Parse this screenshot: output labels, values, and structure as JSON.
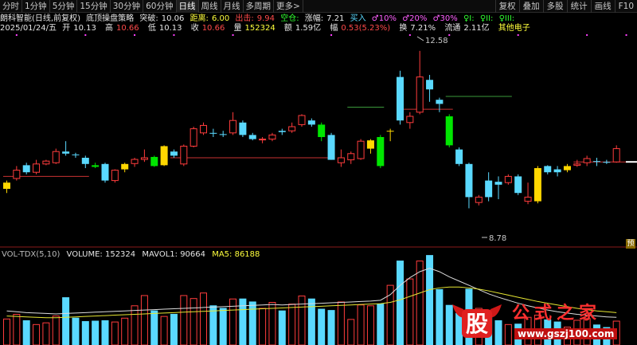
{
  "toolbar": {
    "periods": [
      "分时",
      "1分钟",
      "5分钟",
      "15分钟",
      "30分钟",
      "60分钟",
      "日线",
      "周线",
      "月线",
      "多周期",
      "更多>"
    ],
    "active_period": "日线",
    "right_tools": [
      "复权",
      "叠加",
      "多股",
      "统计",
      "画线",
      "F10"
    ]
  },
  "header": {
    "stock_name": "朗科智能(日线,前复权)",
    "strategy": "底顶操盘策略",
    "break_label": "突破:",
    "break_value": "10.06",
    "distance_label": "距离:",
    "distance_value": "6.00",
    "exit_label": "出击:",
    "exit_value": "9.94",
    "empty_label": "空仓:",
    "rise_label": "涨幅:",
    "rise_value": "7.21",
    "buy_signal": "买入",
    "male_signal_1": "♂10%",
    "male_signal_2": "♂20%",
    "male_signal_3": "♂30%",
    "female_signal_1": "♀I:",
    "female_signal_2": "♀II:",
    "female_signal_3": "♀III:"
  },
  "quote": {
    "date": "2025/01/24/五",
    "open_label": "开",
    "open": "10.13",
    "high_label": "高",
    "high": "10.66",
    "low_label": "低",
    "low": "10.13",
    "close_label": "收",
    "close": "10.66",
    "volume_label": "量",
    "volume": "152324",
    "amount_label": "额",
    "amount": "1.59亿",
    "amp_label": "幅",
    "amp": "0.53(5.23%)",
    "turnover_label": "换",
    "turnover": "7.21%",
    "float_label": "流通",
    "float": "2.11亿",
    "sector": "其他电子"
  },
  "annotations": {
    "high_marker": "12.58",
    "low_marker": "8.78"
  },
  "indicator": {
    "name": "VOL-TDX(5,10)",
    "volume": "VOLUME: 152324",
    "mavol1": "MAVOL1: 90664",
    "ma5": "MA5: 86188"
  },
  "scroll_badge": "预",
  "watermark": {
    "logo_char": "股",
    "title": "公式之家",
    "url": "www.gszj100.com"
  },
  "colors": {
    "up": "#ff3c3c",
    "down": "#5ad9ff",
    "yellow": "#ffd700",
    "green": "#00e600",
    "support": "#c83232",
    "resist": "#3a9a3a",
    "ma_white": "#dcdcdc",
    "ma_yellow": "#e6e632"
  },
  "chart_data": {
    "type": "candlestick",
    "price_ylim": [
      8.0,
      13.0
    ],
    "volume_ylim": [
      0,
      200000
    ],
    "candles": [
      {
        "o": 9.25,
        "c": 9.4,
        "h": 9.45,
        "l": 9.15,
        "st": "yellow"
      },
      {
        "o": 9.5,
        "c": 9.7,
        "h": 9.8,
        "l": 9.45,
        "st": "up"
      },
      {
        "o": 9.82,
        "c": 9.65,
        "h": 9.88,
        "l": 9.6,
        "st": "down"
      },
      {
        "o": 9.65,
        "c": 9.85,
        "h": 9.95,
        "l": 9.6,
        "st": "up"
      },
      {
        "o": 9.85,
        "c": 9.92,
        "h": 9.95,
        "l": 9.82,
        "st": "up"
      },
      {
        "o": 9.88,
        "c": 10.15,
        "h": 10.22,
        "l": 9.85,
        "st": "up"
      },
      {
        "o": 10.15,
        "c": 10.1,
        "h": 10.4,
        "l": 10.05,
        "st": "down"
      },
      {
        "o": 10.08,
        "c": 10.08,
        "h": 10.12,
        "l": 10.0,
        "st": "down"
      },
      {
        "o": 10.0,
        "c": 9.85,
        "h": 10.05,
        "l": 9.75,
        "st": "down"
      },
      {
        "o": 9.78,
        "c": 9.82,
        "h": 9.88,
        "l": 9.75,
        "st": "green"
      },
      {
        "o": 9.85,
        "c": 9.45,
        "h": 9.88,
        "l": 9.4,
        "st": "down"
      },
      {
        "o": 9.45,
        "c": 9.7,
        "h": 9.72,
        "l": 9.4,
        "st": "up"
      },
      {
        "o": 9.72,
        "c": 9.85,
        "h": 9.88,
        "l": 9.65,
        "st": "yellow"
      },
      {
        "o": 9.86,
        "c": 9.96,
        "h": 10.0,
        "l": 9.78,
        "st": "up"
      },
      {
        "o": 9.96,
        "c": 10.0,
        "h": 10.2,
        "l": 9.9,
        "st": "up"
      },
      {
        "o": 9.8,
        "c": 10.02,
        "h": 10.05,
        "l": 9.78,
        "st": "green"
      },
      {
        "o": 9.82,
        "c": 10.28,
        "h": 10.3,
        "l": 9.8,
        "st": "yellow"
      },
      {
        "o": 10.15,
        "c": 10.05,
        "h": 10.2,
        "l": 10.0,
        "st": "down"
      },
      {
        "o": 9.85,
        "c": 10.28,
        "h": 10.32,
        "l": 9.8,
        "st": "up"
      },
      {
        "o": 10.28,
        "c": 10.7,
        "h": 10.75,
        "l": 10.25,
        "st": "up"
      },
      {
        "o": 10.6,
        "c": 10.78,
        "h": 10.85,
        "l": 10.55,
        "st": "up"
      },
      {
        "o": 10.6,
        "c": 10.58,
        "h": 10.7,
        "l": 10.5,
        "st": "down"
      },
      {
        "o": 10.55,
        "c": 10.57,
        "h": 10.65,
        "l": 10.5,
        "st": "down"
      },
      {
        "o": 10.6,
        "c": 10.9,
        "h": 11.1,
        "l": 10.55,
        "st": "up"
      },
      {
        "o": 10.85,
        "c": 10.55,
        "h": 10.9,
        "l": 10.5,
        "st": "down"
      },
      {
        "o": 10.55,
        "c": 10.45,
        "h": 10.6,
        "l": 10.42,
        "st": "down"
      },
      {
        "o": 10.45,
        "c": 10.45,
        "h": 10.5,
        "l": 10.35,
        "st": "up"
      },
      {
        "o": 10.45,
        "c": 10.55,
        "h": 10.6,
        "l": 10.4,
        "st": "up"
      },
      {
        "o": 10.62,
        "c": 10.65,
        "h": 10.7,
        "l": 10.55,
        "st": "down"
      },
      {
        "o": 10.65,
        "c": 10.75,
        "h": 10.85,
        "l": 10.6,
        "st": "up"
      },
      {
        "o": 10.8,
        "c": 11.02,
        "h": 11.05,
        "l": 10.75,
        "st": "up"
      },
      {
        "o": 10.9,
        "c": 10.8,
        "h": 10.95,
        "l": 10.75,
        "st": "down"
      },
      {
        "o": 10.8,
        "c": 10.5,
        "h": 10.85,
        "l": 10.4,
        "st": "green"
      },
      {
        "o": 10.55,
        "c": 9.95,
        "h": 10.6,
        "l": 9.95,
        "st": "down"
      },
      {
        "o": 10.0,
        "c": 9.88,
        "h": 10.2,
        "l": 9.78,
        "st": "up"
      },
      {
        "o": 9.95,
        "c": 10.1,
        "h": 10.15,
        "l": 9.85,
        "st": "up"
      },
      {
        "o": 9.98,
        "c": 10.4,
        "h": 10.45,
        "l": 9.95,
        "st": "up"
      },
      {
        "o": 10.42,
        "c": 10.22,
        "h": 10.45,
        "l": 10.1,
        "st": "yellow"
      },
      {
        "o": 10.5,
        "c": 9.8,
        "h": 10.55,
        "l": 9.75,
        "st": "green"
      },
      {
        "o": 10.65,
        "c": 10.65,
        "h": 10.7,
        "l": 10.4,
        "st": "yellow"
      },
      {
        "o": 10.9,
        "c": 11.95,
        "h": 12.1,
        "l": 10.8,
        "st": "down"
      },
      {
        "o": 10.85,
        "c": 11.0,
        "h": 11.1,
        "l": 10.7,
        "st": "up"
      },
      {
        "o": 11.1,
        "c": 11.95,
        "h": 12.58,
        "l": 11.05,
        "st": "up"
      },
      {
        "o": 11.88,
        "c": 11.65,
        "h": 12.0,
        "l": 11.35,
        "st": "down"
      },
      {
        "o": 11.4,
        "c": 11.3,
        "h": 11.45,
        "l": 11.1,
        "st": "down"
      },
      {
        "o": 11.0,
        "c": 10.3,
        "h": 11.05,
        "l": 10.25,
        "st": "green"
      },
      {
        "o": 10.2,
        "c": 9.85,
        "h": 10.25,
        "l": 9.8,
        "st": "down"
      },
      {
        "o": 9.85,
        "c": 9.05,
        "h": 9.88,
        "l": 8.78,
        "st": "down"
      },
      {
        "o": 9.05,
        "c": 8.92,
        "h": 9.1,
        "l": 8.85,
        "st": "up"
      },
      {
        "o": 9.05,
        "c": 9.45,
        "h": 9.65,
        "l": 8.95,
        "st": "down"
      },
      {
        "o": 9.35,
        "c": 9.42,
        "h": 9.55,
        "l": 9.0,
        "st": "down"
      },
      {
        "o": 9.4,
        "c": 9.55,
        "h": 9.6,
        "l": 9.35,
        "st": "up"
      },
      {
        "o": 9.55,
        "c": 9.15,
        "h": 9.6,
        "l": 9.1,
        "st": "down"
      },
      {
        "o": 9.05,
        "c": 8.95,
        "h": 9.4,
        "l": 8.88,
        "st": "up"
      },
      {
        "o": 8.95,
        "c": 9.75,
        "h": 9.8,
        "l": 8.9,
        "st": "yellow"
      },
      {
        "o": 9.8,
        "c": 9.65,
        "h": 9.82,
        "l": 9.6,
        "st": "down"
      },
      {
        "o": 9.65,
        "c": 9.72,
        "h": 9.8,
        "l": 9.55,
        "st": "down"
      },
      {
        "o": 9.7,
        "c": 9.8,
        "h": 9.85,
        "l": 9.65,
        "st": "yellow"
      },
      {
        "o": 9.82,
        "c": 9.85,
        "h": 9.95,
        "l": 9.78,
        "st": "up"
      },
      {
        "o": 9.88,
        "c": 9.98,
        "h": 10.05,
        "l": 9.8,
        "st": "up"
      },
      {
        "o": 9.92,
        "c": 9.9,
        "h": 10.0,
        "l": 9.8,
        "st": "down"
      },
      {
        "o": 9.9,
        "c": 9.88,
        "h": 9.95,
        "l": 9.85,
        "st": "down"
      },
      {
        "o": 9.9,
        "c": 10.22,
        "h": 10.3,
        "l": 9.88,
        "st": "up"
      }
    ],
    "volumes": [
      61000,
      72000,
      58000,
      48000,
      52000,
      68000,
      112000,
      64000,
      56000,
      57000,
      58000,
      54000,
      63000,
      92000,
      116000,
      81000,
      67000,
      73000,
      116000,
      109000,
      122000,
      93000,
      87000,
      108000,
      109000,
      102000,
      86000,
      100000,
      81000,
      96000,
      115000,
      109000,
      85000,
      82000,
      101000,
      60000,
      94000,
      92000,
      97000,
      140000,
      198000,
      155000,
      197000,
      211000,
      131000,
      94000,
      75000,
      132000,
      86000,
      75000,
      58000,
      48000,
      50000,
      65000,
      70000,
      60000,
      55000,
      42000,
      58000,
      62000,
      48000,
      42000,
      56000
    ],
    "ma_white": [
      80000,
      78000,
      76000,
      75000,
      74000,
      73000,
      74000,
      75000,
      76000,
      77000,
      78000,
      79000,
      80000,
      81000,
      82000,
      83000,
      84000,
      85000,
      86000,
      87000,
      88000,
      89000,
      90000,
      91000,
      92000,
      93000,
      94000,
      95000,
      94000,
      95000,
      96000,
      97000,
      98000,
      99000,
      100000,
      101000,
      102000,
      103000,
      105000,
      118000,
      140000,
      158000,
      172000,
      180000,
      172000,
      160000,
      150000,
      140000,
      130000,
      120000,
      112000,
      105000,
      98000,
      92000,
      87000,
      82000,
      78000,
      75000,
      72000,
      70000,
      68000,
      66000,
      65000
    ],
    "ma_yellow": [
      68000,
      67000,
      66000,
      65000,
      64000,
      64000,
      65000,
      66000,
      67000,
      68000,
      69000,
      70000,
      71000,
      72000,
      73000,
      74000,
      75000,
      76000,
      77000,
      78000,
      79000,
      80000,
      81000,
      82000,
      83000,
      84000,
      85000,
      86000,
      87000,
      88000,
      89000,
      90000,
      91000,
      92000,
      93000,
      94000,
      95000,
      96000,
      97000,
      100000,
      106000,
      114000,
      122000,
      130000,
      134000,
      136000,
      136000,
      134000,
      131000,
      127000,
      122000,
      117000,
      112000,
      107000,
      102000,
      98000,
      94000,
      90000,
      86000,
      83000,
      80000,
      78000,
      76000
    ],
    "support_lines": [
      {
        "from": 0,
        "to": 8,
        "y": 9.55
      },
      {
        "from": 17,
        "to": 33,
        "y": 10.0
      },
      {
        "from": 40,
        "to": 45,
        "y": 11.17
      },
      {
        "from": 58,
        "to": 63,
        "y": 9.9
      }
    ],
    "resist_lines": [
      {
        "from": 45,
        "to": 51,
        "y": 11.48
      },
      {
        "from": 35,
        "to": 38,
        "y": 11.22
      }
    ],
    "magenta_dot_indices": [
      1,
      8,
      13,
      17,
      23,
      33,
      41,
      45,
      52,
      59,
      63
    ]
  }
}
